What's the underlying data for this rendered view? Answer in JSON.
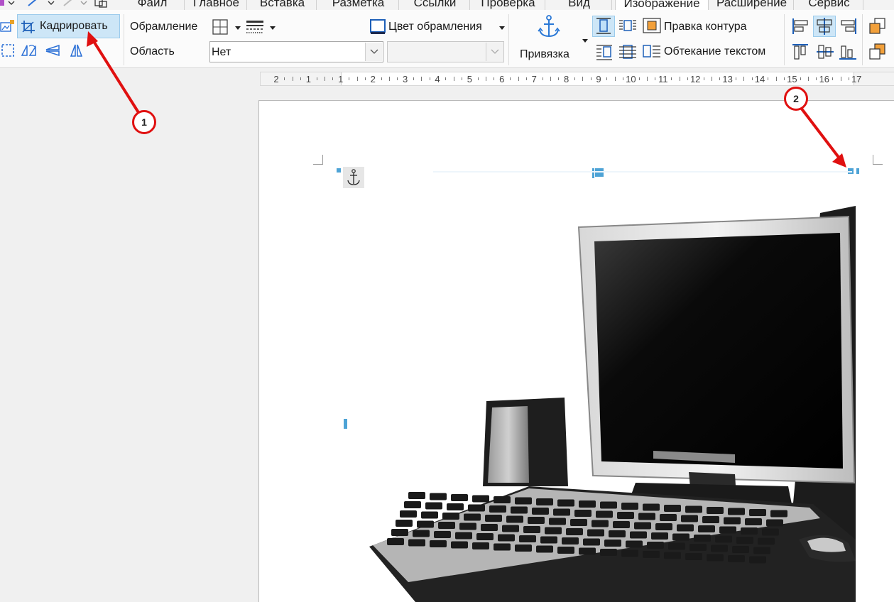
{
  "menu": {
    "tabs": [
      {
        "label": "Файл"
      },
      {
        "label": "Главное"
      },
      {
        "label": "Вставка"
      },
      {
        "label": "Разметка"
      },
      {
        "label": "Ссылки"
      },
      {
        "label": "Проверка"
      },
      {
        "label": "Вид"
      },
      {
        "label": "Изображение"
      },
      {
        "label": "Расширение"
      },
      {
        "label": "Сервис"
      }
    ],
    "active_tab": "Изображение"
  },
  "ribbon": {
    "crop_label": "Кадрировать",
    "border_label": "Обрамление",
    "area_label": "Область",
    "area_value": "Нет",
    "border_color_label": "Цвет обрамления",
    "anchor_label": "Привязка",
    "contour_label": "Правка контура",
    "wrap_label": "Обтекание текстом"
  },
  "ruler": {
    "labels": [
      "2",
      "1",
      "1",
      "2",
      "3",
      "4",
      "5",
      "6",
      "7",
      "8",
      "9",
      "10",
      "11",
      "12",
      "13",
      "14",
      "15",
      "16",
      "17"
    ]
  },
  "annotations": [
    {
      "label": "1"
    },
    {
      "label": "2"
    }
  ],
  "colors": {
    "annotation": "#e01010",
    "handle": "#4da3d6",
    "crop_button_bg": "#cde6f7"
  },
  "icons": [
    "crop-icon",
    "anchor-icon",
    "border-icon",
    "line-style-icon",
    "border-color-icon",
    "align-left-icon",
    "align-center-icon",
    "align-right-icon",
    "wrap-text-icon",
    "contour-icon"
  ]
}
